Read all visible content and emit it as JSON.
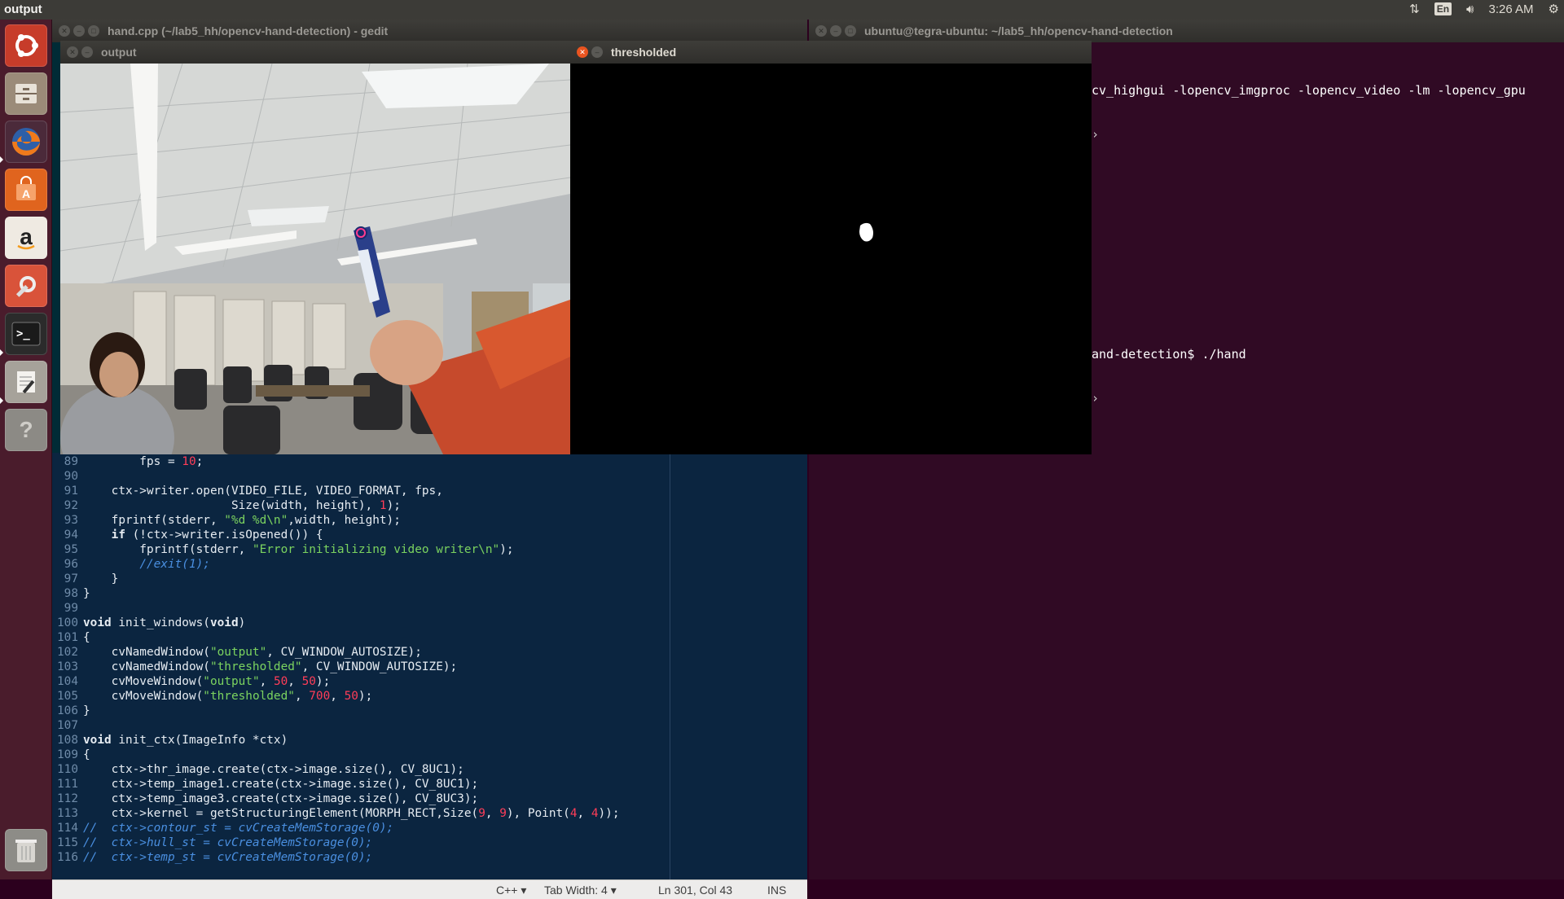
{
  "topbar": {
    "title": "output",
    "keyboard": "En",
    "time": "3:26 AM"
  },
  "launcher": {
    "items": [
      {
        "name": "dash-home",
        "icon": "ubuntu-logo-icon",
        "color": "#c73c2a"
      },
      {
        "name": "files",
        "icon": "filing-cabinet-icon",
        "color": "#8a7a6a"
      },
      {
        "name": "firefox",
        "icon": "firefox-icon",
        "color": "#e56b1f"
      },
      {
        "name": "software-center",
        "icon": "shopping-bag-icon",
        "color": "#e0641e"
      },
      {
        "name": "amazon",
        "icon": "amazon-icon",
        "color": "#e8e2d8"
      },
      {
        "name": "system-settings",
        "icon": "wrench-gear-icon",
        "color": "#d9533a"
      },
      {
        "name": "terminal",
        "icon": "terminal-icon",
        "color": "#2b2b2b"
      },
      {
        "name": "text-editor",
        "icon": "text-editor-icon",
        "color": "#9a968f"
      },
      {
        "name": "help",
        "icon": "question-icon",
        "color": "#8c8a85"
      },
      {
        "name": "trash",
        "icon": "trash-icon",
        "color": "#8d8c87"
      }
    ]
  },
  "terminal": {
    "title": "ubuntu@tegra-ubuntu: ~/lab5_hh/opencv-hand-detection",
    "lines": [
      "cv_highgui -lopencv_imgproc -lopencv_video -lm -lopencv_gpu",
      "",
      "",
      "",
      "",
      "and-detection$ ./hand"
    ]
  },
  "gedit": {
    "title": "hand.cpp (~/lab5_hh/opencv-hand-detection) - gedit",
    "status": {
      "language": "C++ ▾",
      "tab_width": "Tab Width: 4 ▾",
      "position": "Ln 301, Col 43",
      "mode": "INS"
    }
  },
  "code_lines": [
    {
      "n": "89",
      "html": "        fps = <span class='n'>10</span>;"
    },
    {
      "n": "90",
      "html": ""
    },
    {
      "n": "91",
      "html": "    ctx->writer.open(VIDEO_FILE, VIDEO_FORMAT, fps,"
    },
    {
      "n": "92",
      "html": "                     Size(width, height), <span class='n'>1</span>);"
    },
    {
      "n": "93",
      "html": "    fprintf(stderr, <span class='s'>\"%d %d\\n\"</span>,width, height);"
    },
    {
      "n": "94",
      "html": "    <span class='k'>if</span> (!ctx->writer.isOpened()) {"
    },
    {
      "n": "95",
      "html": "        fprintf(stderr, <span class='s'>\"Error initializing video writer\\n\"</span>);"
    },
    {
      "n": "96",
      "html": "        <span class='c'>//exit(1);</span>"
    },
    {
      "n": "97",
      "html": "    }"
    },
    {
      "n": "98",
      "html": "}"
    },
    {
      "n": "99",
      "html": ""
    },
    {
      "n": "100",
      "html": "<span class='k'>void</span> init_windows(<span class='k'>void</span>)"
    },
    {
      "n": "101",
      "html": "{"
    },
    {
      "n": "102",
      "html": "    cvNamedWindow(<span class='s'>\"output\"</span>, CV_WINDOW_AUTOSIZE);"
    },
    {
      "n": "103",
      "html": "    cvNamedWindow(<span class='s'>\"thresholded\"</span>, CV_WINDOW_AUTOSIZE);"
    },
    {
      "n": "104",
      "html": "    cvMoveWindow(<span class='s'>\"output\"</span>, <span class='n'>50</span>, <span class='n'>50</span>);"
    },
    {
      "n": "105",
      "html": "    cvMoveWindow(<span class='s'>\"thresholded\"</span>, <span class='n'>700</span>, <span class='n'>50</span>);"
    },
    {
      "n": "106",
      "html": "}"
    },
    {
      "n": "107",
      "html": ""
    },
    {
      "n": "108",
      "html": "<span class='k'>void</span> init_ctx(ImageInfo *ctx)"
    },
    {
      "n": "109",
      "html": "{"
    },
    {
      "n": "110",
      "html": "    ctx->thr_image.create(ctx->image.size(), CV_8UC1);"
    },
    {
      "n": "111",
      "html": "    ctx->temp_image1.create(ctx->image.size(), CV_8UC1);"
    },
    {
      "n": "112",
      "html": "    ctx->temp_image3.create(ctx->image.size(), CV_8UC3);"
    },
    {
      "n": "113",
      "html": "    ctx->kernel = getStructuringElement(MORPH_RECT,Size(<span class='n'>9</span>, <span class='n'>9</span>), Point(<span class='n'>4</span>, <span class='n'>4</span>));"
    },
    {
      "n": "114",
      "html": "<span class='c'>//  ctx->contour_st = cvCreateMemStorage(0);</span>"
    },
    {
      "n": "115",
      "html": "<span class='c'>//  ctx->hull_st = cvCreateMemStorage(0);</span>"
    },
    {
      "n": "116",
      "html": "<span class='c'>//  ctx->temp_st = cvCreateMemStorage(0);</span>"
    }
  ],
  "output_window": {
    "title": "output"
  },
  "thresholded_window": {
    "title": "thresholded"
  }
}
